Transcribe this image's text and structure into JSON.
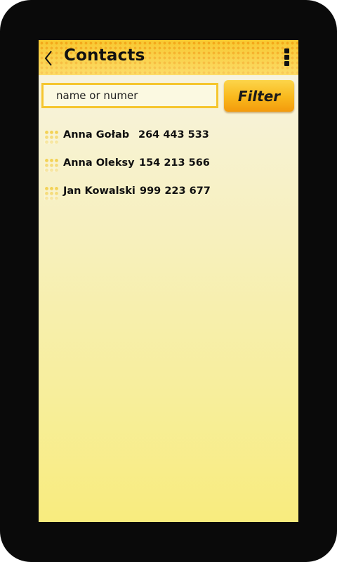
{
  "header": {
    "title": "Contacts",
    "back_icon": "chevron-left-icon",
    "menu_icon": "overflow-menu-icon"
  },
  "search": {
    "placeholder": "name or numer",
    "value": ""
  },
  "filter_button": {
    "label": "Filter"
  },
  "contacts": [
    {
      "name": "Anna Gołab",
      "phone": "264 443 533"
    },
    {
      "name": "Anna Oleksy",
      "phone": "154 213 566"
    },
    {
      "name": "Jan Kowalski",
      "phone": "999 223 677"
    }
  ],
  "colors": {
    "accent": "#f8c830",
    "accent_dark": "#f39a0c",
    "frame": "#0a0a0a",
    "text": "#111111"
  }
}
